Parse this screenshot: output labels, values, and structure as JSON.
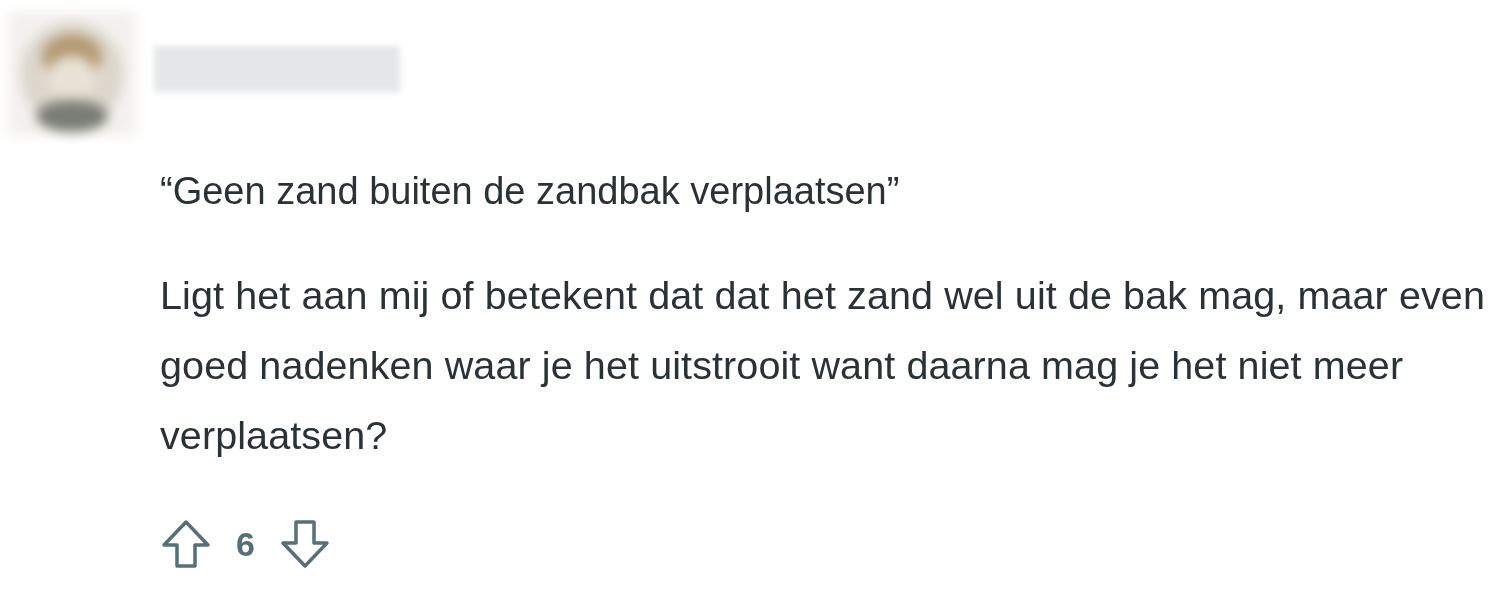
{
  "comment": {
    "quote": "“Geen zand buiten de zandbak verplaatsen”",
    "body": "Ligt het aan mij of betekent dat dat het zand wel uit de bak mag, maar even goed nadenken waar je het uitstrooit want daarna mag je het niet meer verplaatsen?",
    "votes": {
      "score": "6"
    }
  }
}
